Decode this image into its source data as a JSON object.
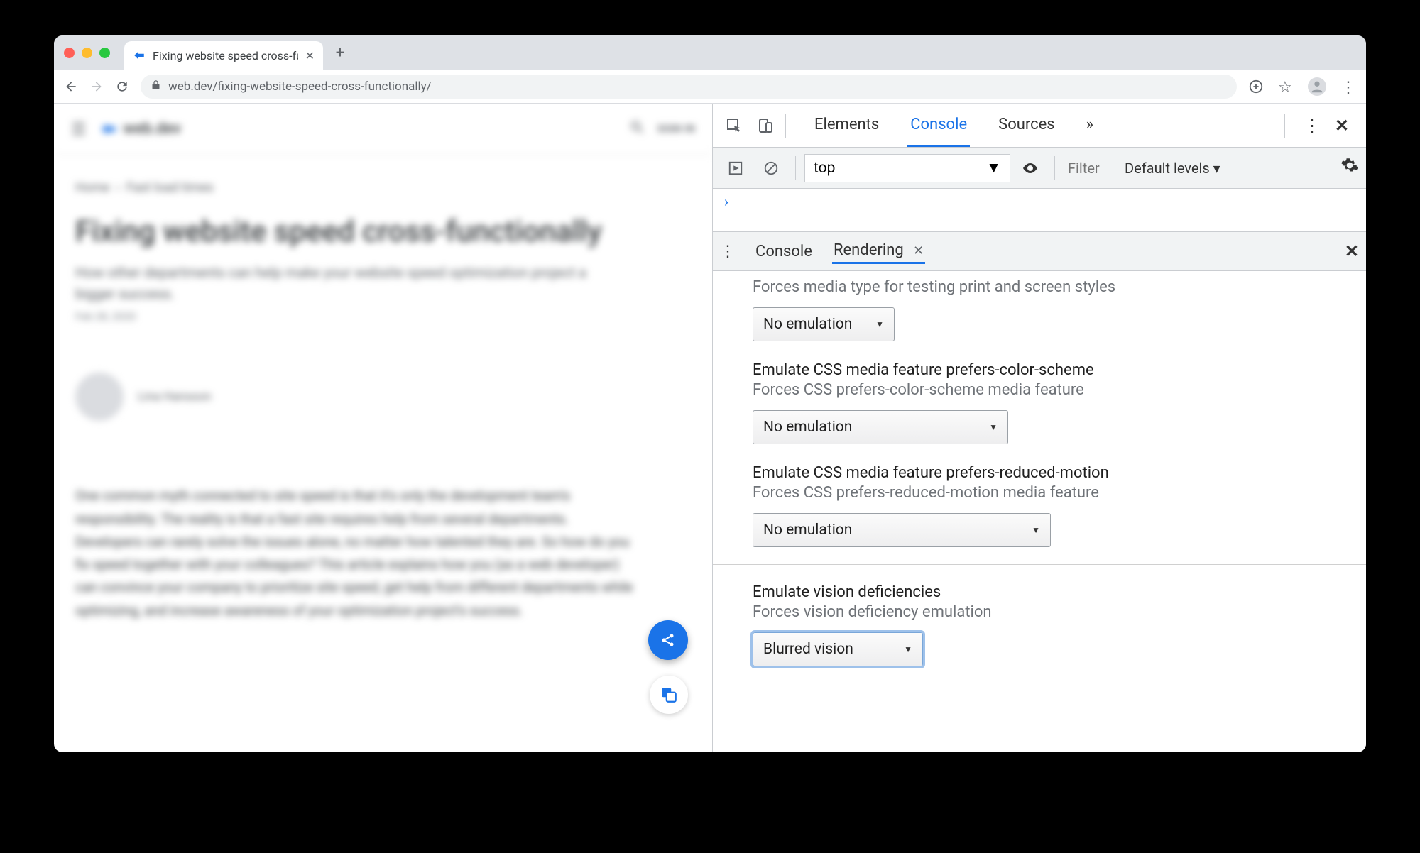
{
  "browser": {
    "tab_title": "Fixing website speed cross-fu",
    "url": "web.dev/fixing-website-speed-cross-functionally/"
  },
  "page": {
    "brand": "web.dev",
    "signin": "SIGN IN",
    "breadcrumbs_home": "Home",
    "breadcrumbs_cat": "Fast load times",
    "title": "Fixing website speed cross-functionally",
    "subtitle": "How other departments can help make your website speed optimization project a bigger success.",
    "date": "Feb 28, 2020",
    "author": "Lina Hansson",
    "body": "One common myth connected to site speed is that it's only the development team's responsibility. The reality is that a fast site requires help from several departments. Developers can rarely solve the issues alone, no matter how talented they are. So how do you fix speed together with your colleagues? This article explains how you (as a web developer) can convince your company to prioritize site speed, get help from different departments while optimizing, and increase awareness of your optimization project's success."
  },
  "devtools": {
    "tabs": {
      "elements": "Elements",
      "console": "Console",
      "sources": "Sources"
    },
    "sub": {
      "context": "top",
      "filter_placeholder": "Filter",
      "levels": "Default levels ▾"
    },
    "console_prompt": "›",
    "drawer": {
      "console": "Console",
      "rendering": "Rendering"
    },
    "rendering": {
      "media_type_desc": "Forces media type for testing print and screen styles",
      "media_type_value": "No emulation",
      "pcs_title": "Emulate CSS media feature prefers-color-scheme",
      "pcs_desc": "Forces CSS prefers-color-scheme media feature",
      "pcs_value": "No emulation",
      "prm_title": "Emulate CSS media feature prefers-reduced-motion",
      "prm_desc": "Forces CSS prefers-reduced-motion media feature",
      "prm_value": "No emulation",
      "vision_title": "Emulate vision deficiencies",
      "vision_desc": "Forces vision deficiency emulation",
      "vision_value": "Blurred vision"
    }
  }
}
